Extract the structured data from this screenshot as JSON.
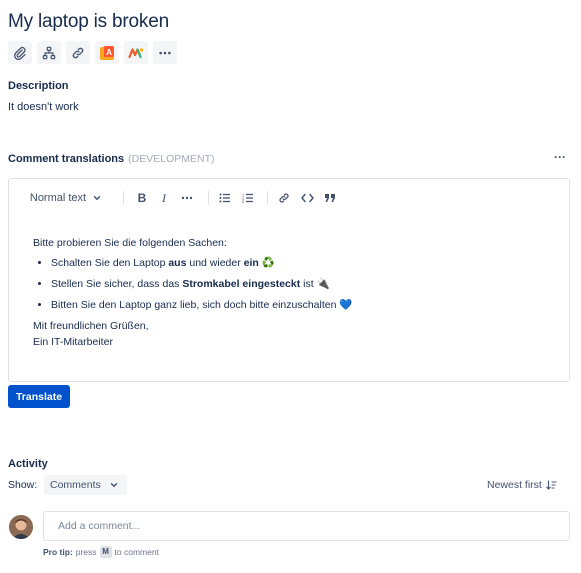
{
  "issue": {
    "title": "My laptop is broken"
  },
  "toolbar_icons": [
    "paperclip-icon",
    "child-issues-icon",
    "link-icon",
    "app-icon-a",
    "app-icon-m",
    "more-icon"
  ],
  "description": {
    "label": "Description",
    "text": "It doesn't work"
  },
  "comment_translations": {
    "label": "Comment translations",
    "tag": "(DEVELOPMENT)",
    "more": "···"
  },
  "editor": {
    "text_style": "Normal text",
    "content": {
      "intro": "Bitte probieren Sie die folgenden Sachen:",
      "items": [
        {
          "a": "Schalten Sie den Laptop ",
          "b1": "aus",
          "c": " und wieder ",
          "b2": "ein",
          "emoji": " ♻️"
        },
        {
          "a": "Stellen Sie sicher, dass das ",
          "b1": "Stromkabel eingesteckt",
          "c": " ist ",
          "emoji": "🔌"
        },
        {
          "a": "Bitten Sie den Laptop ganz lieb, sich doch bitte einzuschalten ",
          "emoji": "💙"
        }
      ],
      "closing": "Mit freundlichen Grüßen,",
      "signature": "Ein IT-Mitarbeiter"
    }
  },
  "translate_button": "Translate",
  "activity": {
    "label": "Activity",
    "show_label": "Show:",
    "filter": "Comments",
    "sort": "Newest first",
    "comment_placeholder": "Add a comment...",
    "protip_bold": "Pro tip:",
    "protip_press": "press",
    "protip_key": "M",
    "protip_rest": "to comment"
  },
  "colors": {
    "primary": "#0052cc",
    "text": "#172b4d",
    "subtle": "#42526e",
    "border": "#dfe1e6"
  }
}
